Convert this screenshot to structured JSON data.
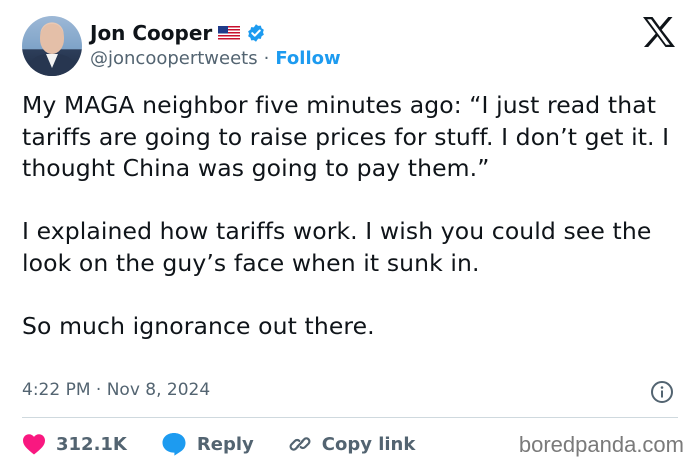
{
  "author": {
    "display_name": "Jon Cooper",
    "handle": "@joncoopertweets",
    "separator": "·",
    "follow_label": "Follow",
    "flag_icon": "us-flag-icon",
    "verified_icon": "verified-badge-icon"
  },
  "tweet": {
    "text": "My MAGA neighbor five minutes ago: “I just read that tariffs are going to raise prices for stuff. I don’t get it. I thought China was going to pay them.”\n\nI explained how tariffs work. I wish you could see the look on the guy’s face when it sunk in.\n\nSo much ignorance out there.",
    "timestamp": "4:22 PM · Nov 8, 2024"
  },
  "actions": {
    "likes_count": "312.1K",
    "reply_label": "Reply",
    "copy_link_label": "Copy link"
  },
  "colors": {
    "accent": "#1d9bf0",
    "like": "#f91880",
    "muted": "#536471"
  },
  "watermark": "boredpanda.com"
}
